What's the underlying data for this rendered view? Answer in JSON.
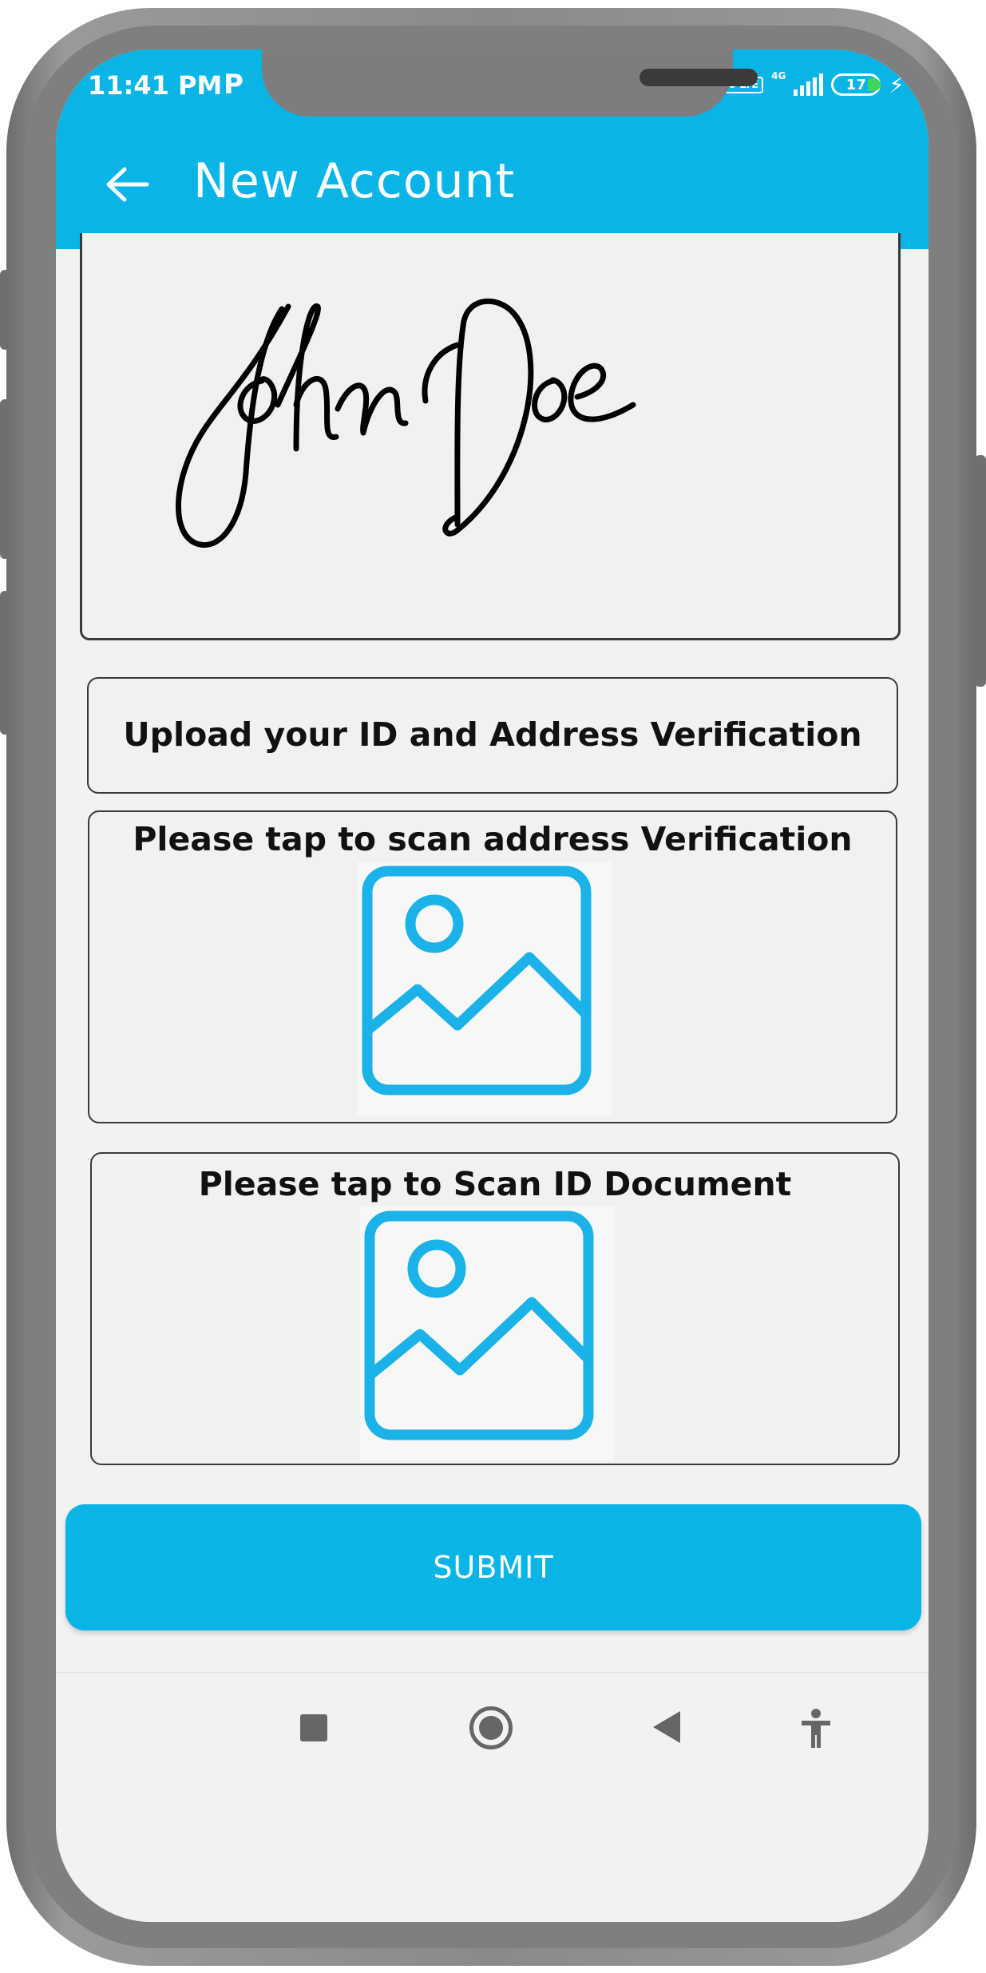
{
  "status": {
    "time": "11:41 PM",
    "app_badge": "P",
    "network": "4G",
    "volte": "Vo LTE",
    "battery": "17"
  },
  "appbar": {
    "title": "New Account",
    "back_icon": "arrow-left-icon"
  },
  "signature": {
    "text": "John Doe"
  },
  "upload_header": {
    "label": "Upload your ID and Address Verification"
  },
  "address_card": {
    "label": "Please tap to scan address Verification",
    "icon": "image-placeholder-icon"
  },
  "id_card": {
    "label": "Please tap to Scan ID Document",
    "icon": "image-placeholder-icon"
  },
  "submit": {
    "label": "SUBMIT"
  },
  "navbar": {
    "items": [
      "recent-apps-icon",
      "home-icon",
      "back-icon",
      "accessibility-icon"
    ]
  },
  "colors": {
    "accent": "#09b4e6",
    "icon": "#1ab2e8"
  }
}
